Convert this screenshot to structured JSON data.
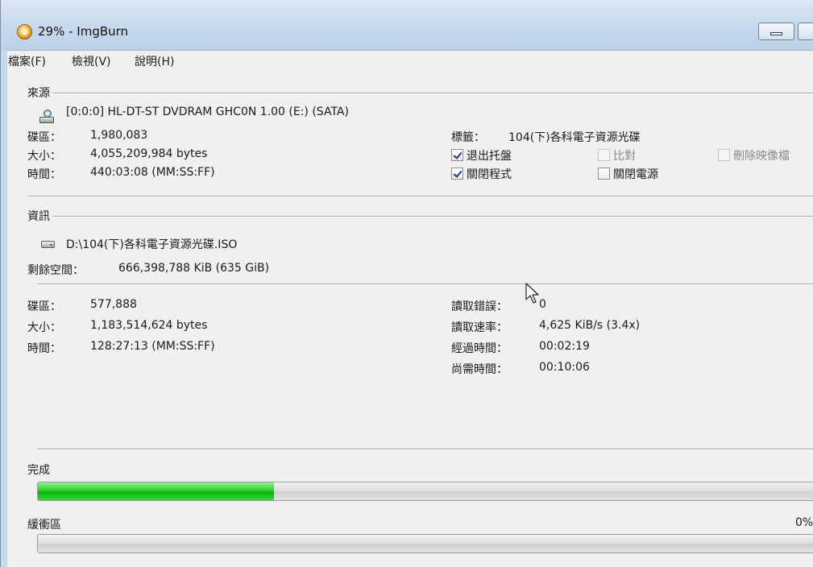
{
  "window": {
    "title": "29% - ImgBurn",
    "icon": "imgburn-app-icon"
  },
  "menu": [
    "檔案(F)",
    "檢視(V)",
    "說明(H)"
  ],
  "source": {
    "group_label": "來源",
    "drive": "[0:0:0] HL-DT-ST DVDRAM GHC0N 1.00 (E:) (SATA)",
    "sectors_label": "碟區：",
    "sectors": "1,980,083",
    "size_label": "大小：",
    "size": "4,055,209,984 bytes",
    "time_label": "時間：",
    "time": "440:03:08 (MM:SS:FF)",
    "volume_label_label": "標籤：",
    "volume_label": "104(下)各科電子資源光碟",
    "options": [
      {
        "label": "退出托盤",
        "checked": true,
        "enabled": true
      },
      {
        "label": "比對",
        "checked": false,
        "enabled": false
      },
      {
        "label": "刪除映像檔",
        "checked": false,
        "enabled": false
      },
      {
        "label": "關閉程式",
        "checked": true,
        "enabled": true
      },
      {
        "label": "關閉電源",
        "checked": false,
        "enabled": true
      }
    ]
  },
  "info": {
    "group_label": "資訊",
    "destination": "D:\\104(下)各科電子資源光碟.ISO",
    "free_space_label": "剩餘空間：",
    "free_space": "666,398,788 KiB  (635 GiB)",
    "sectors_label": "碟區：",
    "sectors": "577,888",
    "size_label": "大小：",
    "size": "1,183,514,624 bytes",
    "time_label": "時間：",
    "time": "128:27:13 (MM:SS:FF)",
    "read_errors_label": "讀取錯誤：",
    "read_errors": "0",
    "read_rate_label": "讀取速率：",
    "read_rate": "4,625 KiB/s (3.4x)",
    "elapsed_label": "經過時間：",
    "elapsed": "00:02:19",
    "remaining_label": "尚需時間：",
    "remaining": "00:10:06"
  },
  "progress": {
    "complete_label": "完成",
    "complete_fraction": 0.3,
    "buffer_label": "緩衝區",
    "buffer_percent": "0%",
    "buffer_fraction": 0
  },
  "colors": {
    "progress_fill": "#06b406",
    "titlebar": "#c7d9ec"
  }
}
